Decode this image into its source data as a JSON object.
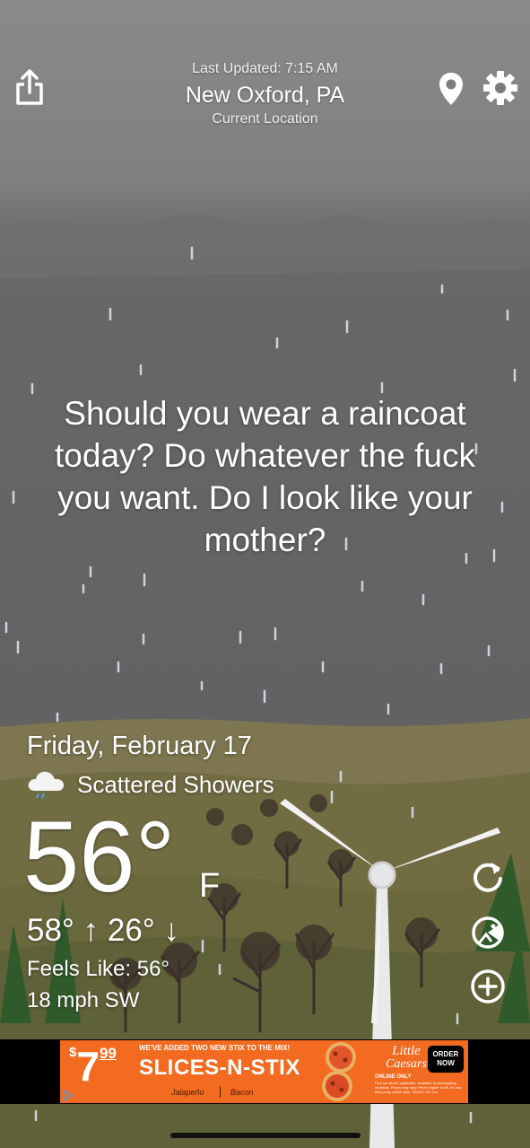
{
  "header": {
    "last_updated": "Last Updated: 7:15 AM",
    "city": "New Oxford, PA",
    "location_label": "Current Location",
    "icons": [
      "share-icon",
      "location-pin-icon",
      "gear-icon"
    ]
  },
  "message": "Should you wear a raincoat today? Do whatever the fuck you want. Do I look like your mother?",
  "weather": {
    "date": "Friday, February 17",
    "condition": "Scattered Showers",
    "condition_icon": "cloud-rain-icon",
    "temperature": "56°",
    "unit": "F",
    "hi_lo": "58° ↑ 26° ↓",
    "feels_like": "Feels Like: 56°",
    "wind": "18 mph SW"
  },
  "side_buttons": [
    "refresh-icon",
    "pacman-icon",
    "plus-circle-icon"
  ],
  "ad": {
    "headline": "WE'VE ADDED TWO NEW STIX TO THE MIX!",
    "price": "$7.99",
    "price_dollar": "$",
    "price_main": "7",
    "price_cents": "99",
    "product": "SLICES-N-STIX",
    "flavor1": "Jalapeño",
    "flavor2": "Bacon",
    "brand": "Little Caesars",
    "brand_line1": "Little",
    "brand_line2": "Caesars",
    "cta_line1": "ORDER",
    "cta_line2": "NOW",
    "online_only": "ONLINE ONLY",
    "fine_print": "Plus tax where applicable. Available at participating locations. Prices may vary. Prices higher in AK, HI and third-party online sites. ©2023 LCE, Inc.",
    "colors": {
      "bg": "#f36b21",
      "cta": "#000000"
    }
  },
  "colors": {
    "sky": "#808080",
    "ground": "#7f7a55",
    "hills": "#6d6a3f"
  }
}
